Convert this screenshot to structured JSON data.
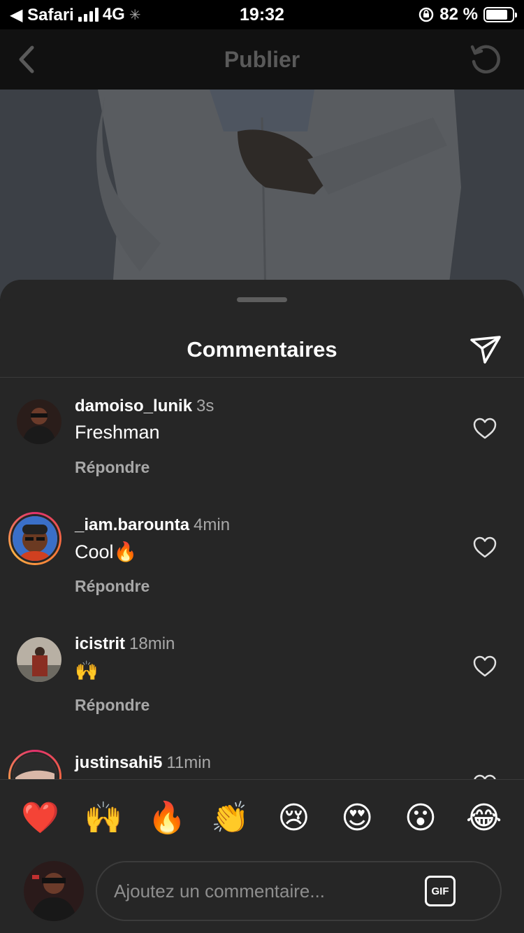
{
  "status_bar": {
    "back_app": "Safari",
    "network": "4G",
    "time": "19:32",
    "battery": "82 %",
    "battery_level": 0.82
  },
  "nav": {
    "title": "Publier"
  },
  "sheet": {
    "title": "Commentaires"
  },
  "comments": [
    {
      "username": "damoiso_lunik",
      "time": "3s",
      "text": "Freshman",
      "reply": "Répondre",
      "story_ring": false
    },
    {
      "username": "_iam.barounta",
      "time": "4min",
      "text": "Cool🔥",
      "reply": "Répondre",
      "story_ring": true
    },
    {
      "username": "icistrit",
      "time": "18min",
      "text": "🙌",
      "reply": "Répondre",
      "story_ring": false
    },
    {
      "username": "justinsahi5",
      "time": "11min",
      "text": "",
      "reply": "",
      "story_ring": true
    }
  ],
  "emoji_bar": [
    "❤️",
    "🙌",
    "🔥",
    "👏",
    "😢",
    "😍",
    "😮",
    "😂"
  ],
  "composer": {
    "placeholder": "Ajoutez un commentaire...",
    "gif_label": "GIF"
  }
}
